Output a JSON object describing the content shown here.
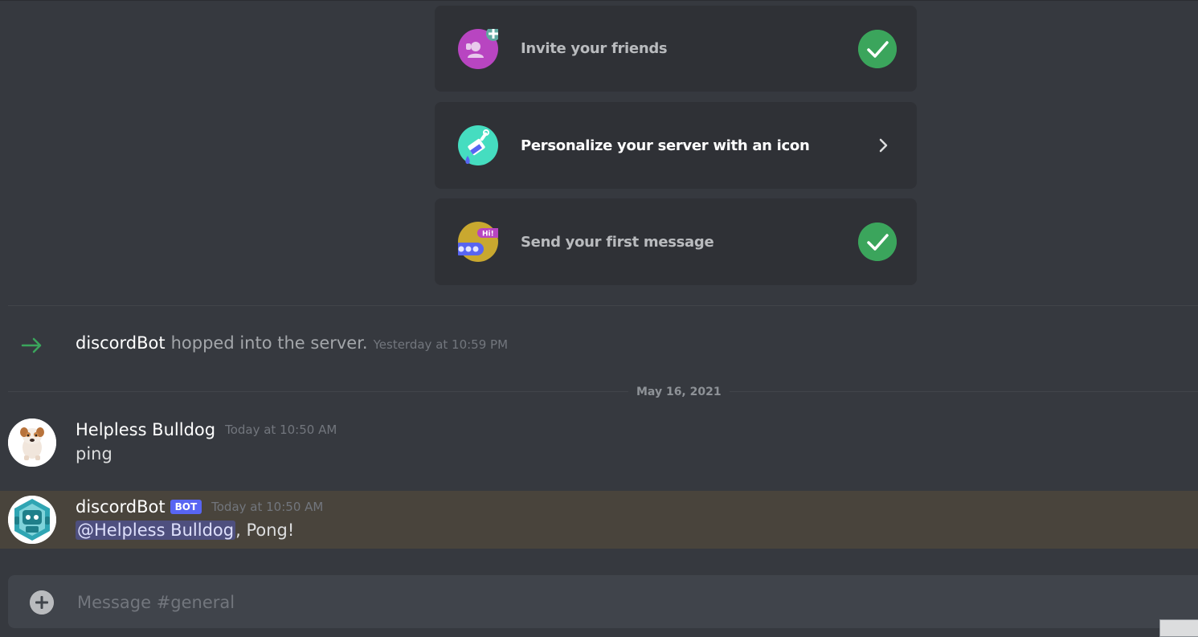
{
  "onboarding": {
    "items": [
      {
        "label": "Invite your friends",
        "status": "done",
        "icon": "invite-friends-icon",
        "accent": "#b845c1"
      },
      {
        "label": "Personalize your server with an icon",
        "status": "todo",
        "icon": "paintbrush-icon",
        "accent": "#45ddc0"
      },
      {
        "label": "Send your first message",
        "status": "done",
        "icon": "chat-bubble-icon",
        "accent": "#c9a82f"
      }
    ]
  },
  "join_message": {
    "user": "discordBot",
    "text": "hopped into the server.",
    "timestamp": "Yesterday at 10:59 PM"
  },
  "date_divider": "May 16, 2021",
  "messages": [
    {
      "author": "Helpless Bulldog",
      "timestamp": "Today at 10:50 AM",
      "content": "ping",
      "avatar": "bulldog-avatar"
    },
    {
      "author": "discordBot",
      "badge": "BOT",
      "timestamp": "Today at 10:50 AM",
      "mention": "@Helpless Bulldog",
      "content_rest": ", Pong!",
      "avatar": "robot-avatar",
      "highlighted": true
    }
  ],
  "composer": {
    "placeholder": "Message #general"
  },
  "colors": {
    "background": "#36393f",
    "card": "#2f3136",
    "success": "#3ba55c",
    "blurple": "#5865f2",
    "mention_highlight": "#49443c"
  }
}
